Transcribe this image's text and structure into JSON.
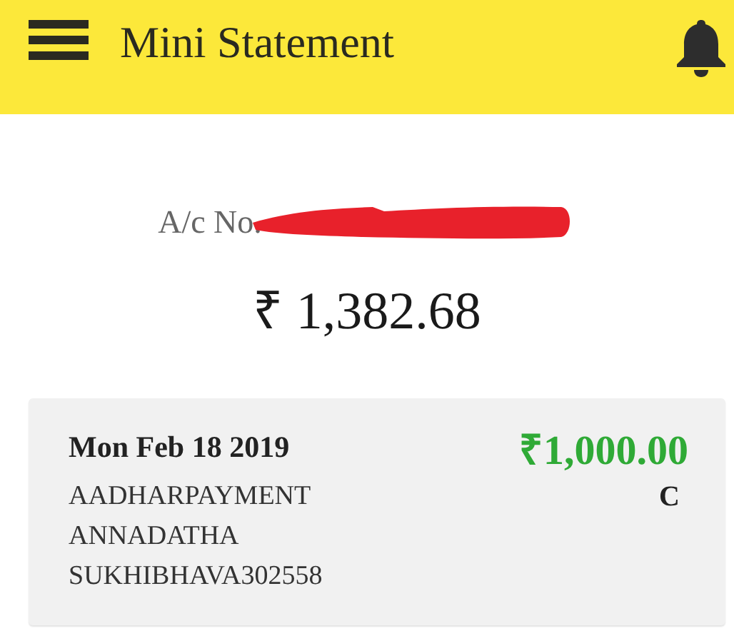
{
  "header": {
    "title": "Mini Statement"
  },
  "account": {
    "label": "A/c No.",
    "redacted": true,
    "balance": "₹ 1,382.68"
  },
  "transactions": [
    {
      "date": "Mon Feb 18 2019",
      "description": "AADHARPAYMENT ANNADATHA SUKHIBHAVA302558",
      "amount": "₹1,000.00",
      "type": "C"
    }
  ]
}
